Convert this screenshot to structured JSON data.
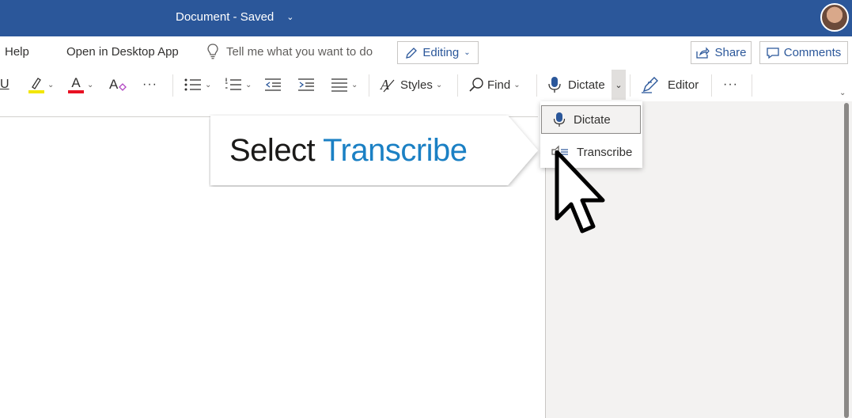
{
  "titlebar": {
    "document_name": "Document",
    "separator": "-",
    "status": "Saved"
  },
  "menu": {
    "help": "Help",
    "open_desktop": "Open in Desktop App",
    "tell_me_placeholder": "Tell me what you want to do",
    "editing": "Editing",
    "share": "Share",
    "comments": "Comments"
  },
  "ribbon": {
    "underline": "U",
    "font_color_letter": "A",
    "styles": "Styles",
    "find": "Find",
    "dictate": "Dictate",
    "editor": "Editor",
    "more": "···"
  },
  "dictate_menu": {
    "items": [
      {
        "label": "Dictate",
        "icon": "microphone-icon"
      },
      {
        "label": "Transcribe",
        "icon": "transcribe-icon"
      }
    ]
  },
  "callout": {
    "prefix": "Select",
    "highlight": "Transcribe"
  },
  "colors": {
    "titlebar": "#2b579a",
    "accent_blue": "#1b80c4",
    "highlight_yellow": "#f2e600",
    "font_color_red": "#e81123"
  }
}
